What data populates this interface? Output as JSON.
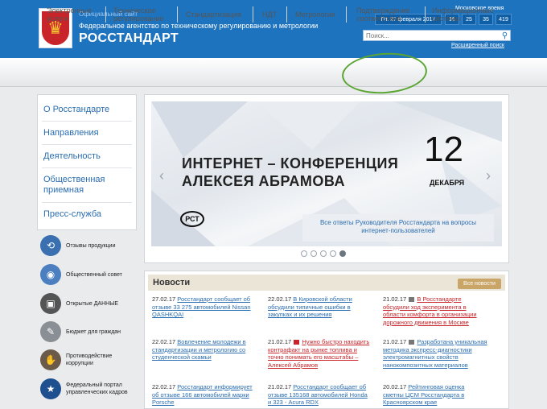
{
  "header": {
    "official": "Официальный сайт",
    "agency": "Федеральное агентство по техническому регулированию и метрологии",
    "brand": "РОССТАНДАРТ",
    "moscow_time_label": "Московское время",
    "date": "Пт. 27 февраля 2017",
    "time": [
      "16",
      "25",
      "35",
      "419"
    ],
    "search_placeholder": "Поиск...",
    "advanced_search": "Расширенный поиск"
  },
  "nav": [
    {
      "line1": "Электронные",
      "line2": "услуги"
    },
    {
      "line1": "Техническое",
      "line2": "регулирование"
    },
    {
      "line1": "Стандартизация",
      "line2": ""
    },
    {
      "line1": "НДТ",
      "line2": ""
    },
    {
      "line1": "Метрология",
      "line2": ""
    },
    {
      "line1": "Подтверждение",
      "line2": "соответствия"
    },
    {
      "line1": "Информационные",
      "line2": "системы"
    }
  ],
  "left_menu": [
    {
      "line1": "О Росстандарте",
      "line2": ""
    },
    {
      "line1": "Направления",
      "line2": ""
    },
    {
      "line1": "Деятельность",
      "line2": ""
    },
    {
      "line1": "Общественная",
      "line2": "приемная"
    },
    {
      "line1": "Пресс-служба",
      "line2": ""
    }
  ],
  "side_links": [
    {
      "line1": "Отзывы продукции",
      "line2": "",
      "icon": "recall-icon",
      "color": "#3a6fb0"
    },
    {
      "line1": "Общественный совет",
      "line2": "",
      "icon": "council-icon",
      "color": "#4b7fbf"
    },
    {
      "line1": "Открытые ДАННЫЕ",
      "line2": "",
      "icon": "open-data-icon",
      "color": "#555555"
    },
    {
      "line1": "Бюджет для граждан",
      "line2": "",
      "icon": "budget-icon",
      "color": "#8a8f96"
    },
    {
      "line1": "Противодействие",
      "line2": "коррупции",
      "icon": "anti-corruption-icon",
      "color": "#6b5a4a"
    },
    {
      "line1": "Федеральный портал",
      "line2": "управленческих кадров",
      "icon": "federal-portal-icon",
      "color": "#1e4f8f"
    }
  ],
  "slider": {
    "title_line1": "ИНТЕРНЕТ – КОНФЕРЕНЦИЯ",
    "title_line2": "АЛЕКСЕЯ АБРАМОВА",
    "day": "12",
    "month": "ДЕКАБРЯ",
    "caption_line1": "Все ответы Руководителя Росстандарта на вопросы",
    "caption_line2": "интернет-пользователей",
    "logo": "РСТ",
    "dots": 5,
    "active_dot": 5
  },
  "news": {
    "title": "Новости",
    "all_label": "Все новости",
    "items": [
      {
        "date": "27.02.17",
        "lines": [
          "Росстандарт сообщает об",
          "отзыве 33 275 автомобилей Nissan",
          "QASHKQAI"
        ],
        "hot": false,
        "icon": ""
      },
      {
        "date": "22.02.17",
        "lines": [
          "В Кировской области",
          "обсудили типичные ошибки в",
          "закупках и их решения"
        ],
        "hot": false,
        "icon": ""
      },
      {
        "date": "21.02.17",
        "lines": [
          "В Росстандарте",
          "обсудили ход эксперимента в",
          "области комфорта в организации",
          "дорожного движения в Москве"
        ],
        "hot": true,
        "icon": "gray"
      },
      {
        "date": "22.02.17",
        "lines": [
          "Вовлечение молодежи в",
          "стандартизации и метрологию со",
          "студенческой скамьи"
        ],
        "hot": false,
        "icon": ""
      },
      {
        "date": "21.02.17",
        "lines": [
          "Нужно быстро находить",
          "контрафакт на рынке топлива и",
          "точно понимать его масштабы –",
          "Алексей Абрамов"
        ],
        "hot": true,
        "icon": "red"
      },
      {
        "date": "21.02.17",
        "lines": [
          "Разработана уникальная",
          "методика экспресс-диагностики",
          "электромагнитных свойств",
          "нанокомпозитных материалов"
        ],
        "hot": false,
        "icon": "gray"
      },
      {
        "date": "22.02.17",
        "lines": [
          "Росстандарт информирует",
          "об отзыве 166 автомобилей марки",
          "Porsche"
        ],
        "hot": false,
        "icon": ""
      },
      {
        "date": "21.02.17",
        "lines": [
          "Росстандарт сообщает об",
          "отзыве 135168 автомобилей Honda",
          "и 323 - Acura RDX"
        ],
        "hot": false,
        "icon": ""
      },
      {
        "date": "20.02.17",
        "lines": [
          "Рейтинговая оценка",
          "сметны ЦСМ Росстандарта в",
          "Красноярском крае"
        ],
        "hot": false,
        "icon": ""
      }
    ]
  }
}
